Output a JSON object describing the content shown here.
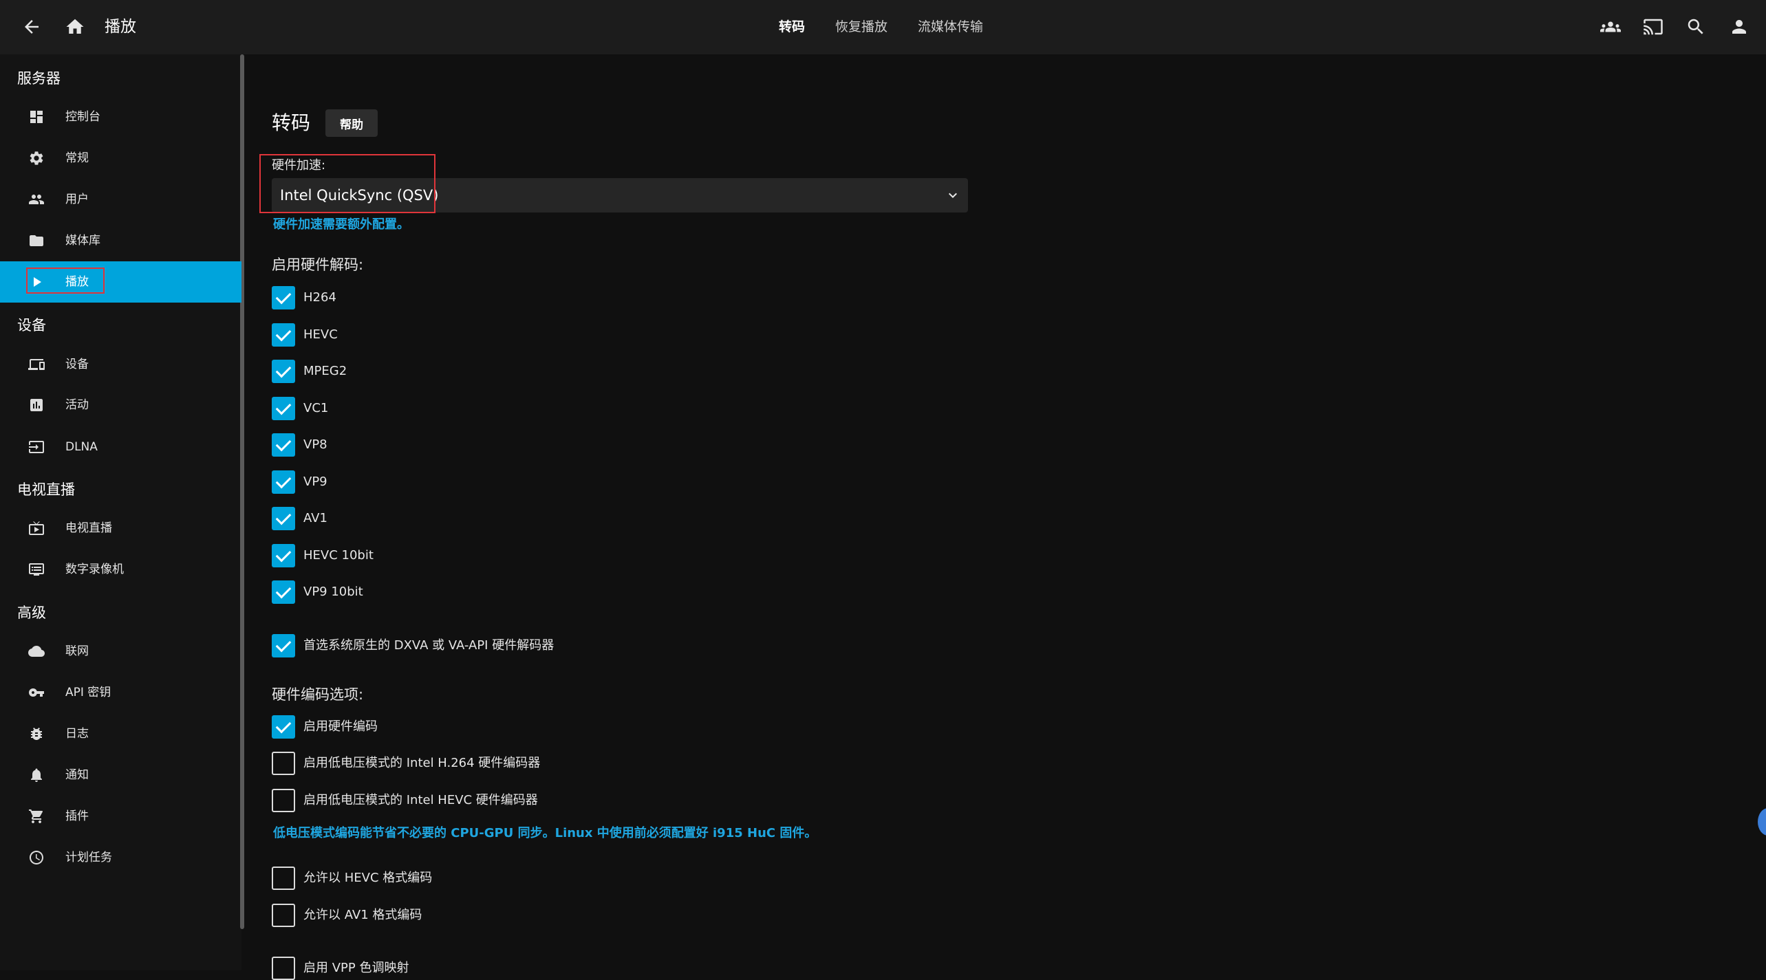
{
  "header": {
    "title": "播放",
    "tabs": [
      {
        "label": "转码",
        "active": true
      },
      {
        "label": "恢复播放",
        "active": false
      },
      {
        "label": "流媒体传输",
        "active": false
      }
    ],
    "icons": [
      "back-arrow-icon",
      "home-icon",
      "users-icon",
      "cast-icon",
      "search-icon",
      "user-icon"
    ]
  },
  "sidebar": {
    "sections": [
      {
        "title": "服务器",
        "items": [
          {
            "label": "控制台",
            "icon": "dashboard-icon"
          },
          {
            "label": "常规",
            "icon": "gear-icon"
          },
          {
            "label": "用户",
            "icon": "people-icon"
          },
          {
            "label": "媒体库",
            "icon": "folder-icon"
          },
          {
            "label": "播放",
            "icon": "play-icon",
            "active": true
          }
        ]
      },
      {
        "title": "设备",
        "items": [
          {
            "label": "设备",
            "icon": "devices-icon"
          },
          {
            "label": "活动",
            "icon": "activity-icon"
          },
          {
            "label": "DLNA",
            "icon": "input-icon"
          }
        ]
      },
      {
        "title": "电视直播",
        "items": [
          {
            "label": "电视直播",
            "icon": "live-tv-icon"
          },
          {
            "label": "数字录像机",
            "icon": "dvr-icon"
          }
        ]
      },
      {
        "title": "高级",
        "items": [
          {
            "label": "联网",
            "icon": "cloud-icon"
          },
          {
            "label": "API 密钥",
            "icon": "key-icon"
          },
          {
            "label": "日志",
            "icon": "bug-icon"
          },
          {
            "label": "通知",
            "icon": "bell-icon"
          },
          {
            "label": "插件",
            "icon": "cart-icon"
          },
          {
            "label": "计划任务",
            "icon": "clock-icon"
          }
        ]
      }
    ]
  },
  "main": {
    "title": "转码",
    "help_label": "帮助",
    "hw_accel_label": "硬件加速:",
    "hw_accel_value": "Intel QuickSync (QSV)",
    "hw_accel_note": "硬件加速需要额外配置。",
    "hw_decode_label": "启用硬件解码:",
    "decoders": [
      {
        "label": "H264",
        "checked": true
      },
      {
        "label": "HEVC",
        "checked": true
      },
      {
        "label": "MPEG2",
        "checked": true
      },
      {
        "label": "VC1",
        "checked": true
      },
      {
        "label": "VP8",
        "checked": true
      },
      {
        "label": "VP9",
        "checked": true
      },
      {
        "label": "AV1",
        "checked": true
      },
      {
        "label": "HEVC 10bit",
        "checked": true
      },
      {
        "label": "VP9 10bit",
        "checked": true
      }
    ],
    "prefer_native": {
      "label": "首选系统原生的 DXVA 或 VA-API 硬件解码器",
      "checked": true
    },
    "hw_encode_label": "硬件编码选项:",
    "encoders": [
      {
        "label": "启用硬件编码",
        "checked": true
      },
      {
        "label": "启用低电压模式的 Intel H.264 硬件编码器",
        "checked": false
      },
      {
        "label": "启用低电压模式的 Intel HEVC 硬件编码器",
        "checked": false
      }
    ],
    "low_power_note": "低电压模式编码能节省不必要的 CPU-GPU 同步。Linux 中使用前必须配置好 i915 HuC 固件。",
    "formats": [
      {
        "label": "允许以 HEVC 格式编码",
        "checked": false
      },
      {
        "label": "允许以 AV1 格式编码",
        "checked": false
      },
      {
        "label": "启用 VPP 色调映射",
        "checked": false
      }
    ]
  },
  "colors": {
    "accent": "#00a4dc",
    "highlight": "#e0353a",
    "link": "#1fa6e0"
  }
}
